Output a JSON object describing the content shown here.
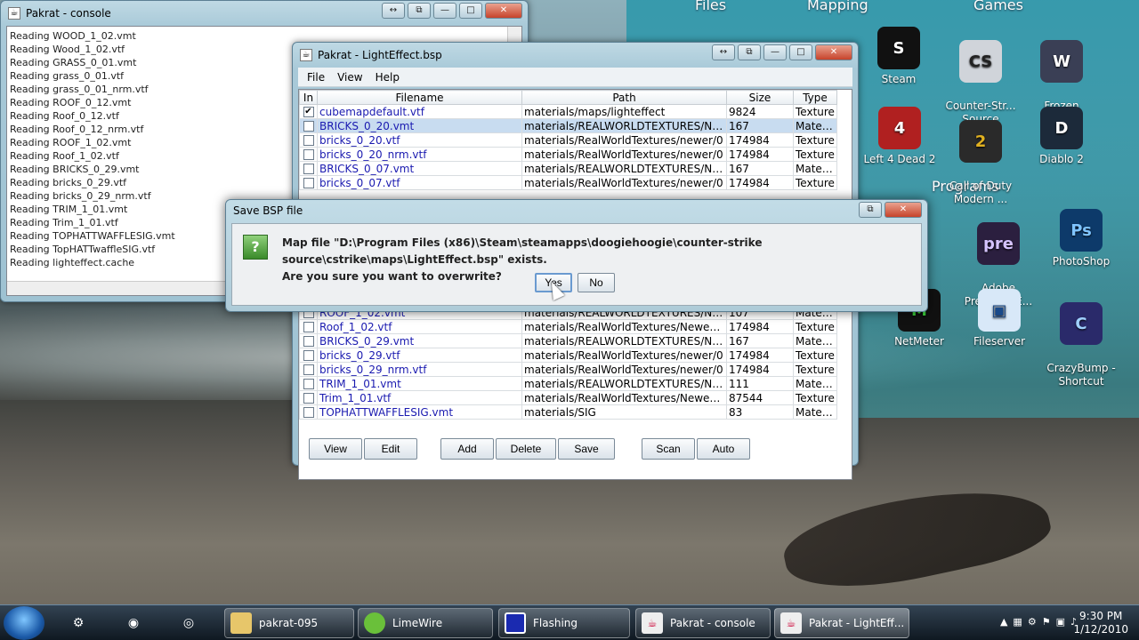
{
  "desktop": {
    "groups": [
      {
        "label": "Files"
      },
      {
        "label": "Mapping"
      },
      {
        "label": "Games"
      },
      {
        "label": "Programs"
      }
    ],
    "icons": {
      "steam": "Steam",
      "cs_source": "Counter-Str...\nSource",
      "frozen_throne": "Frozen\nThrone",
      "l4d2": "Left 4 Dead 2",
      "cod": "Call of Duty\nModern ...",
      "diablo2": "Diablo 2",
      "premiere": "Adobe\nPremiere E...",
      "photoshop": "PhotoShop",
      "netmeter": "NetMeter",
      "fileserver": "Fileserver",
      "crazybump": "CrazyBump -\nShortcut"
    }
  },
  "console_window": {
    "title": "Pakrat - console",
    "lines": [
      "Reading WOOD_1_02.vmt",
      "Reading Wood_1_02.vtf",
      "Reading GRASS_0_01.vmt",
      "Reading grass_0_01.vtf",
      "Reading grass_0_01_nrm.vtf",
      "Reading ROOF_0_12.vmt",
      "Reading Roof_0_12.vtf",
      "Reading Roof_0_12_nrm.vtf",
      "Reading ROOF_1_02.vmt",
      "Reading Roof_1_02.vtf",
      "Reading BRICKS_0_29.vmt",
      "Reading bricks_0_29.vtf",
      "Reading bricks_0_29_nrm.vtf",
      "Reading TRIM_1_01.vmt",
      "Reading Trim_1_01.vtf",
      "Reading TOPHATTWAFFLESIG.vmt",
      "Reading TopHATTwaffleSIG.vtf",
      "Reading lighteffect.cache"
    ]
  },
  "main_window": {
    "title": "Pakrat - LightEffect.bsp",
    "menu": [
      "File",
      "View",
      "Help"
    ],
    "columns": [
      "In",
      "Filename",
      "Path",
      "Size",
      "Type"
    ],
    "rows_top": [
      {
        "in": true,
        "filename": "cubemapdefault.vtf",
        "path": "materials/maps/lighteffect",
        "size": "9824",
        "type": "Texture",
        "selected": false
      },
      {
        "in": false,
        "filename": "BRICKS_0_20.vmt",
        "path": "materials/REALWORLDTEXTURES/NE...",
        "size": "167",
        "type": "Material",
        "selected": true
      },
      {
        "in": false,
        "filename": "bricks_0_20.vtf",
        "path": "materials/RealWorldTextures/newer/0",
        "size": "174984",
        "type": "Texture",
        "selected": false
      },
      {
        "in": false,
        "filename": "bricks_0_20_nrm.vtf",
        "path": "materials/RealWorldTextures/newer/0",
        "size": "174984",
        "type": "Texture",
        "selected": false
      },
      {
        "in": false,
        "filename": "BRICKS_0_07.vmt",
        "path": "materials/REALWORLDTEXTURES/NE...",
        "size": "167",
        "type": "Material",
        "selected": false
      },
      {
        "in": false,
        "filename": "bricks_0_07.vtf",
        "path": "materials/RealWorldTextures/newer/0",
        "size": "174984",
        "type": "Texture",
        "selected": false
      }
    ],
    "rows_bottom": [
      {
        "in": false,
        "filename": "ROOF_1_02.vmt",
        "path": "materials/REALWORLDTEXTURES/NE...",
        "size": "107",
        "type": "Material"
      },
      {
        "in": false,
        "filename": "Roof_1_02.vtf",
        "path": "materials/RealWorldTextures/Newer/1",
        "size": "174984",
        "type": "Texture"
      },
      {
        "in": false,
        "filename": "BRICKS_0_29.vmt",
        "path": "materials/REALWORLDTEXTURES/NE...",
        "size": "167",
        "type": "Material"
      },
      {
        "in": false,
        "filename": "bricks_0_29.vtf",
        "path": "materials/RealWorldTextures/newer/0",
        "size": "174984",
        "type": "Texture"
      },
      {
        "in": false,
        "filename": "bricks_0_29_nrm.vtf",
        "path": "materials/RealWorldTextures/newer/0",
        "size": "174984",
        "type": "Texture"
      },
      {
        "in": false,
        "filename": "TRIM_1_01.vmt",
        "path": "materials/REALWORLDTEXTURES/NE...",
        "size": "111",
        "type": "Material"
      },
      {
        "in": false,
        "filename": "Trim_1_01.vtf",
        "path": "materials/RealWorldTextures/Newer/1",
        "size": "87544",
        "type": "Texture"
      },
      {
        "in": false,
        "filename": "TOPHATTWAFFLESIG.vmt",
        "path": "materials/SIG",
        "size": "83",
        "type": "Material"
      }
    ],
    "buttons": [
      "View",
      "Edit",
      "Add",
      "Delete",
      "Save",
      "Scan",
      "Auto"
    ]
  },
  "dialog": {
    "title": "Save BSP file",
    "message_line1": "Map file \"D:\\Program Files (x86)\\Steam\\steamapps\\doogiehoogie\\counter-strike source\\cstrike\\maps\\LightEffect.bsp\" exists.",
    "message_line2": "Are you sure you want to overwrite?",
    "yes_label": "Yes",
    "no_label": "No",
    "icon_glyph": "?"
  },
  "taskbar": {
    "tasks": [
      {
        "label": "pakrat-095"
      },
      {
        "label": "LimeWire"
      },
      {
        "label": "Flashing"
      },
      {
        "label": "Pakrat - console"
      },
      {
        "label": "Pakrat - LightEff..."
      }
    ],
    "time": "9:30 PM",
    "date": "1/12/2010"
  },
  "colors": {
    "selection": "#c8dcf0",
    "filename_text": "#1a1ab0"
  }
}
